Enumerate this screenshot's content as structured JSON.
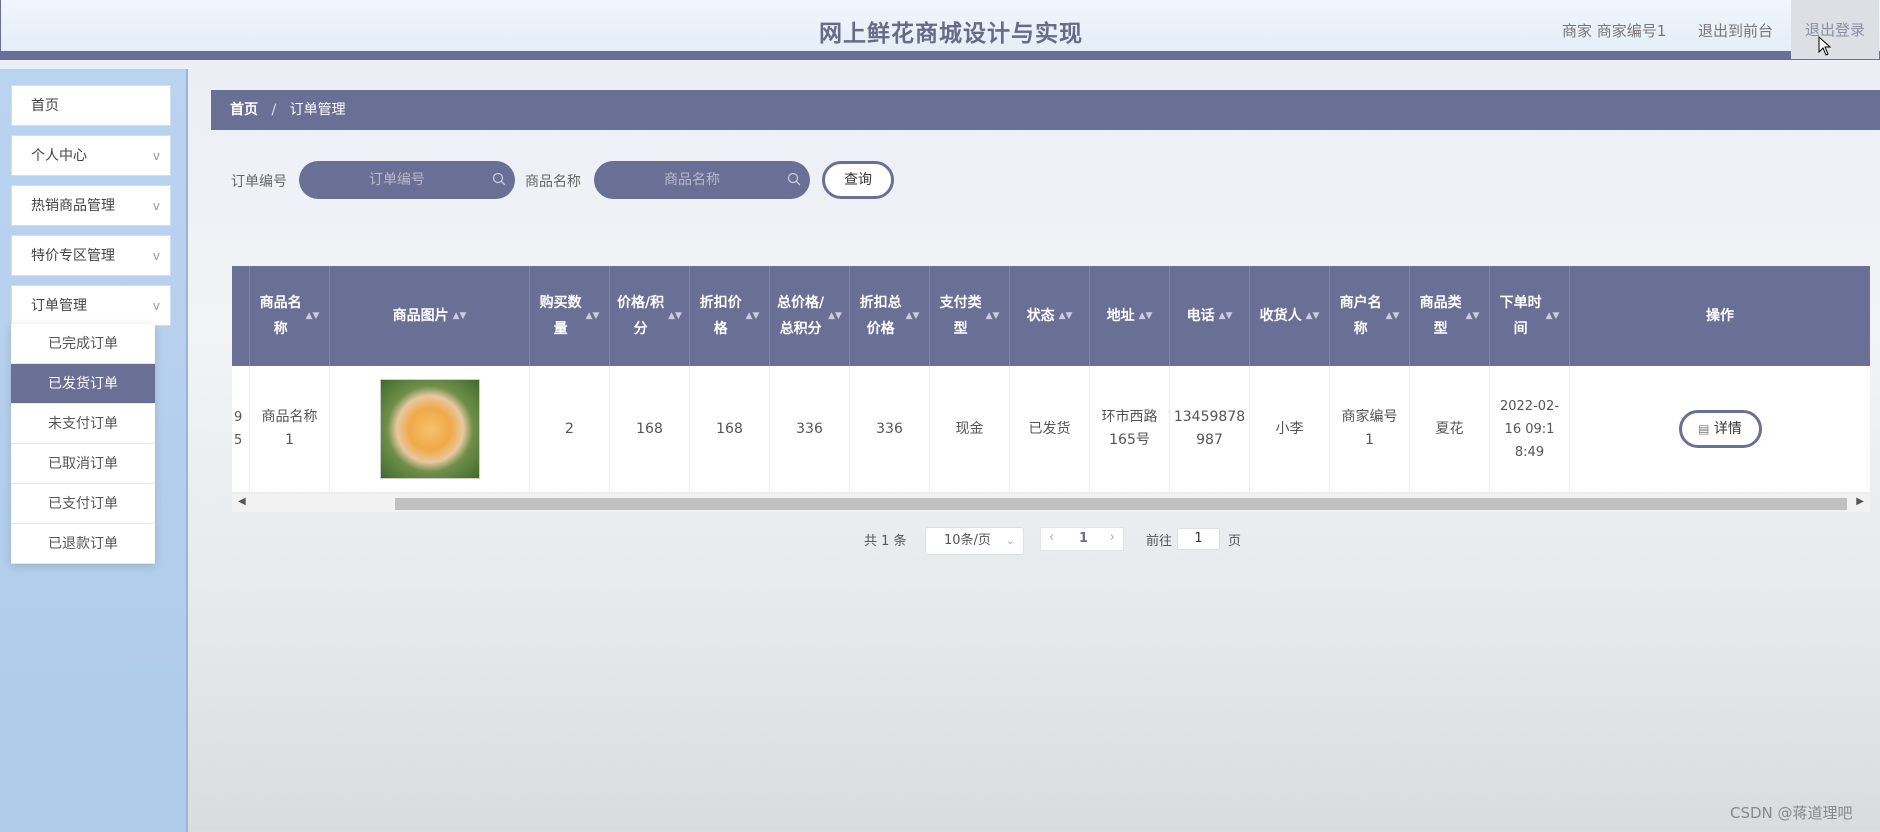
{
  "header": {
    "title": "网上鲜花商城设计与实现",
    "user": "商家  商家编号1",
    "back_to_front": "退出到前台",
    "logout": "退出登录"
  },
  "sidebar": {
    "items": [
      {
        "label": "首页"
      },
      {
        "label": "个人中心"
      },
      {
        "label": "热销商品管理"
      },
      {
        "label": "特价专区管理"
      },
      {
        "label": "订单管理"
      }
    ],
    "chevron": "v",
    "submenu": [
      {
        "label": "已完成订单"
      },
      {
        "label": "已发货订单"
      },
      {
        "label": "未支付订单"
      },
      {
        "label": "已取消订单"
      },
      {
        "label": "已支付订单"
      },
      {
        "label": "已退款订单"
      }
    ],
    "active_submenu": "已发货订单"
  },
  "breadcrumb": {
    "home": "首页",
    "sep": "/",
    "current": "订单管理"
  },
  "search": {
    "order_no_label": "订单编号",
    "order_no_placeholder": "订单编号",
    "product_name_label": "商品名称",
    "product_name_placeholder": "商品名称",
    "query_button": "查询"
  },
  "table": {
    "columns": [
      {
        "label": "商品名\n称"
      },
      {
        "label": "商品图片"
      },
      {
        "label": "购买数\n量"
      },
      {
        "label": "价格/积\n分"
      },
      {
        "label": "折扣价\n格"
      },
      {
        "label": "总价格/\n总积分"
      },
      {
        "label": "折扣总\n价格"
      },
      {
        "label": "支付类\n型"
      },
      {
        "label": "状态"
      },
      {
        "label": "地址"
      },
      {
        "label": "电话"
      },
      {
        "label": "收货人"
      },
      {
        "label": "商户名\n称"
      },
      {
        "label": "商品类\n型"
      },
      {
        "label": "下单时\n间"
      },
      {
        "label": "操作"
      }
    ],
    "sort_glyph": "▲▼",
    "row": {
      "clipped": "9\n5",
      "product_name": "商品名称\n1",
      "quantity": "2",
      "price": "168",
      "discount_price": "168",
      "total": "336",
      "discount_total": "336",
      "pay_type": "现金",
      "status": "已发货",
      "address": "环市西路\n165号",
      "phone": "13459878\n987",
      "receiver": "小李",
      "merchant": "商家编号\n1",
      "category": "夏花",
      "order_time": "2022-02-\n16 09:1\n8:49",
      "detail_button": "详情"
    }
  },
  "pagination": {
    "total": "共 1 条",
    "page_size": "10条/页",
    "current_page": "1",
    "goto_label": "前往",
    "goto_value": "1",
    "page_suffix": "页"
  },
  "watermark": "CSDN @蒋道理吧"
}
